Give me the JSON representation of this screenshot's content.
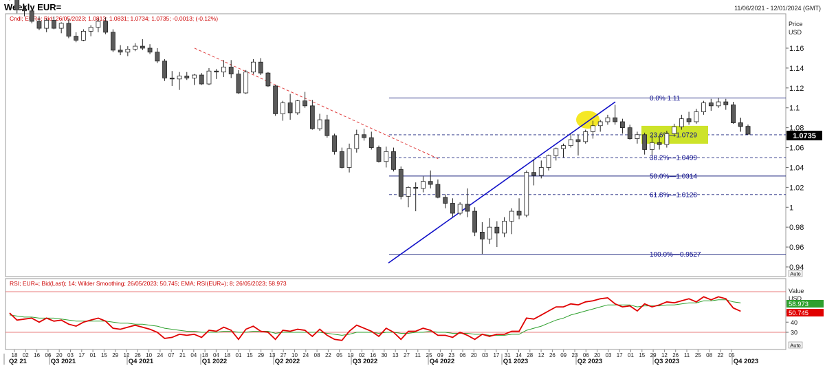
{
  "header": {
    "title": "Weekly EUR=",
    "date_range": "11/06/2021 - 12/01/2024 (GMT)"
  },
  "price_panel": {
    "legend": "Cndl; EUR=; Bid; 26/05/2023; 1.0813; 1.0831; 1.0734; 1.0735; -0.0013; (-0.12%)",
    "axis_title": "Price",
    "axis_unit": "USD",
    "last_price_label": "1.0735",
    "auto_label": "Auto"
  },
  "rsi_panel": {
    "legend": "RSI; EUR=; Bid(Last); 14; Wilder Smoothing; 26/05/2023; 50.745; EMA; RSI(EUR=); 8; 26/05/2023; 58.973",
    "axis_title": "Value",
    "axis_unit": "USD",
    "ema_last_label": "58.973",
    "rsi_last_label": "50.745",
    "auto_label": "Auto"
  },
  "colors": {
    "candle_up": "#ffffff",
    "candle_down": "#5a5a5a",
    "candle_outline": "#222222",
    "trend_line": "#1010c8",
    "resistance_line": "#e04040",
    "fib_line": "#1a237e",
    "fib_text": "#0a0a8c",
    "highlight_fill": "#cde32a",
    "yellow_circle": "#f3e400",
    "rsi_line": "#e00000",
    "ema_line": "#2ea02e",
    "rsi_band": "#e05050"
  },
  "chart_data": [
    {
      "type": "candlestick",
      "title": "Weekly EUR=",
      "ylabel": "Price USD",
      "ylim": [
        0.93,
        1.175
      ],
      "yticks": [
        0.94,
        0.96,
        0.98,
        1,
        1.02,
        1.04,
        1.06,
        1.08,
        1.1,
        1.12,
        1.14,
        1.16
      ],
      "ytick_labels": [
        "0.94",
        "0.96",
        "0.98",
        "1",
        "1.02",
        "1.04",
        "1.06",
        "1.08",
        "1.1",
        "1.12",
        "1.14",
        "1.16"
      ],
      "x_day_labels": [
        "18",
        "02",
        "16",
        "06",
        "20",
        "03",
        "17",
        "01",
        "15",
        "29",
        "12",
        "26",
        "10",
        "24",
        "07",
        "21",
        "04",
        "18",
        "04",
        "18",
        "01",
        "15",
        "29",
        "13",
        "27",
        "10",
        "24",
        "08",
        "22",
        "05",
        "19",
        "02",
        "16",
        "30",
        "13",
        "27",
        "11",
        "25",
        "09",
        "23",
        "06",
        "20",
        "03",
        "17",
        "31",
        "14",
        "28",
        "12",
        "26",
        "09",
        "23",
        "06",
        "20",
        "03",
        "17",
        "01",
        "15",
        "29",
        "12",
        "26",
        "11",
        "25",
        "08",
        "22",
        "05"
      ],
      "quarters": [
        "Q2 21",
        "Q3 2021",
        "Q4 2021",
        "Q1 2022",
        "Q2 2022",
        "Q3 2022",
        "Q4 2022",
        "Q1 2023",
        "Q2 2023",
        "Q3 2023",
        "Q4 2023"
      ],
      "candles": [
        [
          1.2125,
          1.216,
          1.208,
          1.2105
        ],
        [
          1.21,
          1.215,
          1.195,
          1.1985
        ],
        [
          1.199,
          1.203,
          1.192,
          1.1975
        ],
        [
          1.1975,
          1.2,
          1.185,
          1.187
        ],
        [
          1.187,
          1.192,
          1.178,
          1.18
        ],
        [
          1.18,
          1.19,
          1.176,
          1.188
        ],
        [
          1.188,
          1.192,
          1.179,
          1.18
        ],
        [
          1.18,
          1.186,
          1.175,
          1.185
        ],
        [
          1.185,
          1.189,
          1.17,
          1.172
        ],
        [
          1.172,
          1.176,
          1.166,
          1.168
        ],
        [
          1.168,
          1.179,
          1.167,
          1.177
        ],
        [
          1.177,
          1.183,
          1.172,
          1.181
        ],
        [
          1.181,
          1.19,
          1.176,
          1.187
        ],
        [
          1.187,
          1.191,
          1.174,
          1.176
        ],
        [
          1.176,
          1.179,
          1.156,
          1.158
        ],
        [
          1.158,
          1.163,
          1.153,
          1.156
        ],
        [
          1.156,
          1.162,
          1.152,
          1.159
        ],
        [
          1.159,
          1.165,
          1.157,
          1.162
        ],
        [
          1.162,
          1.169,
          1.158,
          1.16
        ],
        [
          1.16,
          1.164,
          1.154,
          1.156
        ],
        [
          1.156,
          1.16,
          1.145,
          1.147
        ],
        [
          1.147,
          1.149,
          1.127,
          1.13
        ],
        [
          1.13,
          1.137,
          1.122,
          1.129
        ],
        [
          1.129,
          1.136,
          1.118,
          1.132
        ],
        [
          1.132,
          1.136,
          1.128,
          1.13
        ],
        [
          1.13,
          1.134,
          1.123,
          1.133
        ],
        [
          1.133,
          1.135,
          1.123,
          1.124
        ],
        [
          1.124,
          1.14,
          1.123,
          1.137
        ],
        [
          1.137,
          1.139,
          1.129,
          1.136
        ],
        [
          1.136,
          1.148,
          1.131,
          1.141
        ],
        [
          1.141,
          1.148,
          1.13,
          1.134
        ],
        [
          1.134,
          1.138,
          1.114,
          1.115
        ],
        [
          1.115,
          1.138,
          1.114,
          1.136
        ],
        [
          1.136,
          1.149,
          1.134,
          1.146
        ],
        [
          1.146,
          1.15,
          1.133,
          1.135
        ],
        [
          1.135,
          1.136,
          1.121,
          1.122
        ],
        [
          1.122,
          1.123,
          1.092,
          1.094
        ],
        [
          1.094,
          1.107,
          1.087,
          1.105
        ],
        [
          1.105,
          1.114,
          1.088,
          1.095
        ],
        [
          1.095,
          1.108,
          1.093,
          1.107
        ],
        [
          1.107,
          1.116,
          1.1,
          1.102
        ],
        [
          1.102,
          1.108,
          1.078,
          1.079
        ],
        [
          1.079,
          1.094,
          1.077,
          1.088
        ],
        [
          1.088,
          1.093,
          1.07,
          1.072
        ],
        [
          1.072,
          1.074,
          1.053,
          1.056
        ],
        [
          1.056,
          1.06,
          1.039,
          1.04
        ],
        [
          1.04,
          1.064,
          1.035,
          1.059
        ],
        [
          1.059,
          1.078,
          1.055,
          1.073
        ],
        [
          1.073,
          1.079,
          1.067,
          1.07
        ],
        [
          1.07,
          1.076,
          1.058,
          1.06
        ],
        [
          1.06,
          1.062,
          1.045,
          1.046
        ],
        [
          1.046,
          1.061,
          1.04,
          1.056
        ],
        [
          1.056,
          1.06,
          1.036,
          1.038
        ],
        [
          1.038,
          1.041,
          1.008,
          1.011
        ],
        [
          1.011,
          1.021,
          1.0,
          1.02
        ],
        [
          1.02,
          1.025,
          0.996,
          1.019
        ],
        [
          1.019,
          1.031,
          1.015,
          1.026
        ],
        [
          1.026,
          1.037,
          1.019,
          1.023
        ],
        [
          1.023,
          1.028,
          1.009,
          1.01
        ],
        [
          1.01,
          1.013,
          0.999,
          1.004
        ],
        [
          1.004,
          1.009,
          0.99,
          0.994
        ],
        [
          0.994,
          1.005,
          0.992,
          1.003
        ],
        [
          1.003,
          1.019,
          0.99,
          0.996
        ],
        [
          0.996,
          1.0,
          0.971,
          0.975
        ],
        [
          0.975,
          0.985,
          0.953,
          0.968
        ],
        [
          0.968,
          0.989,
          0.963,
          0.98
        ],
        [
          0.98,
          0.986,
          0.96,
          0.974
        ],
        [
          0.974,
          0.99,
          0.97,
          0.986
        ],
        [
          0.986,
          0.999,
          0.973,
          0.996
        ],
        [
          0.996,
          1.009,
          0.988,
          0.992
        ],
        [
          0.992,
          1.037,
          0.99,
          1.035
        ],
        [
          1.035,
          1.048,
          1.022,
          1.032
        ],
        [
          1.032,
          1.047,
          1.029,
          1.04
        ],
        [
          1.04,
          1.053,
          1.037,
          1.052
        ],
        [
          1.052,
          1.06,
          1.047,
          1.059
        ],
        [
          1.059,
          1.064,
          1.05,
          1.062
        ],
        [
          1.062,
          1.074,
          1.06,
          1.068
        ],
        [
          1.068,
          1.073,
          1.052,
          1.066
        ],
        [
          1.066,
          1.078,
          1.064,
          1.076
        ],
        [
          1.076,
          1.087,
          1.069,
          1.082
        ],
        [
          1.082,
          1.088,
          1.076,
          1.086
        ],
        [
          1.086,
          1.093,
          1.083,
          1.09
        ],
        [
          1.09,
          1.103,
          1.083,
          1.086
        ],
        [
          1.086,
          1.089,
          1.074,
          1.08
        ],
        [
          1.08,
          1.083,
          1.068,
          1.069
        ],
        [
          1.069,
          1.076,
          1.064,
          1.073
        ],
        [
          1.073,
          1.075,
          1.053,
          1.058
        ],
        [
          1.058,
          1.072,
          1.052,
          1.065
        ],
        [
          1.065,
          1.072,
          1.058,
          1.063
        ],
        [
          1.063,
          1.077,
          1.06,
          1.074
        ],
        [
          1.074,
          1.084,
          1.071,
          1.081
        ],
        [
          1.081,
          1.093,
          1.078,
          1.089
        ],
        [
          1.089,
          1.096,
          1.083,
          1.086
        ],
        [
          1.086,
          1.099,
          1.084,
          1.096
        ],
        [
          1.096,
          1.107,
          1.093,
          1.105
        ],
        [
          1.105,
          1.109,
          1.097,
          1.102
        ],
        [
          1.102,
          1.11,
          1.1,
          1.106
        ],
        [
          1.106,
          1.109,
          1.098,
          1.103
        ],
        [
          1.103,
          1.106,
          1.084,
          1.085
        ],
        [
          1.085,
          1.09,
          1.076,
          1.0813
        ],
        [
          1.0813,
          1.0831,
          1.0734,
          1.0735
        ]
      ],
      "resistance_line": {
        "from": [
          0,
          1.16
        ],
        "to": [
          0.16,
          1.048
        ],
        "label": ""
      },
      "support_line": {
        "from": [
          -0.05,
          0.944
        ],
        "to": [
          0.9,
          1.106
        ],
        "label": ""
      },
      "fib_levels": [
        {
          "pct": "0.0%",
          "value": "1.11",
          "style": "solid"
        },
        {
          "pct": "23.6%",
          "value": "1.0729",
          "style": "dashed",
          "highlight": true
        },
        {
          "pct": "38.2%",
          "value": "1.0499",
          "style": "dashed"
        },
        {
          "pct": "50.0%",
          "value": "1.0314",
          "style": "solid"
        },
        {
          "pct": "61.8%",
          "value": "1.0128",
          "style": "dashed"
        },
        {
          "pct": "100.0%",
          "value": "0.9527",
          "style": "solid"
        }
      ],
      "last_price": 1.0735
    },
    {
      "type": "line",
      "title": "RSI",
      "ylim": [
        24,
        71
      ],
      "yticks": [
        30,
        40,
        50
      ],
      "ytick_labels": [
        "30",
        "40",
        "50"
      ],
      "bands": [
        30,
        70
      ],
      "series": [
        {
          "name": "RSI",
          "values": [
            49,
            42,
            43,
            44,
            40,
            44,
            41,
            42,
            38,
            36,
            40,
            42,
            44,
            41,
            34,
            33,
            35,
            37,
            35,
            33,
            30,
            24,
            25,
            28,
            27,
            28,
            25,
            32,
            31,
            35,
            32,
            23,
            33,
            36,
            31,
            30,
            23,
            32,
            31,
            33,
            32,
            26,
            33,
            27,
            23,
            22,
            31,
            37,
            34,
            31,
            26,
            34,
            30,
            23,
            31,
            31,
            34,
            32,
            27,
            27,
            25,
            30,
            27,
            23,
            28,
            26,
            28,
            28,
            31,
            31,
            44,
            43,
            47,
            51,
            55,
            55,
            58,
            57,
            60,
            61,
            63,
            64,
            58,
            55,
            56,
            51,
            58,
            55,
            57,
            60,
            59,
            61,
            63,
            60,
            65,
            62,
            65,
            63,
            54,
            50.745
          ]
        },
        {
          "name": "EMA",
          "values": [
            47,
            46,
            45,
            45,
            44,
            44,
            44,
            43,
            42,
            41,
            41,
            41,
            41,
            41,
            40,
            39,
            39,
            38,
            38,
            37,
            36,
            34,
            33,
            32,
            31,
            31,
            30,
            30,
            30,
            31,
            31,
            30,
            30,
            31,
            31,
            31,
            29,
            30,
            30,
            30,
            30,
            30,
            30,
            29,
            28,
            27,
            28,
            30,
            30,
            30,
            29,
            30,
            30,
            29,
            29,
            30,
            30,
            31,
            30,
            30,
            29,
            29,
            29,
            28,
            28,
            27,
            27,
            27,
            28,
            28,
            32,
            34,
            36,
            39,
            42,
            44,
            47,
            49,
            51,
            53,
            55,
            57,
            57,
            57,
            57,
            55,
            56,
            56,
            56,
            57,
            57,
            58,
            59,
            59,
            61,
            61,
            62,
            62,
            60,
            58.973
          ]
        }
      ]
    }
  ]
}
